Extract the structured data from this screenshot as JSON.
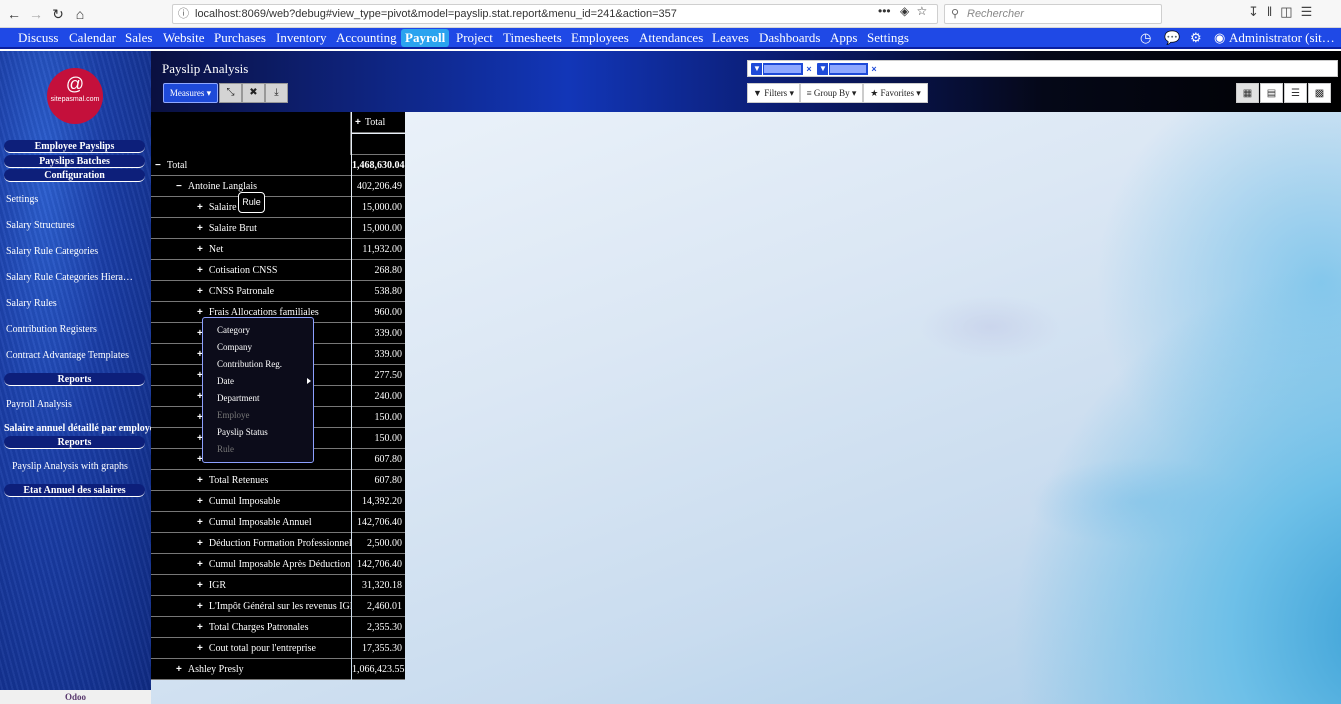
{
  "browser": {
    "url": "localhost:8069/web?debug#view_type=pivot&model=payslip.stat.report&menu_id=241&action=357",
    "url_actions": "•••",
    "search_placeholder": "Rechercher"
  },
  "topnav": {
    "items": [
      "Discuss",
      "Calendar",
      "Sales",
      "Website",
      "Purchases",
      "Inventory",
      "Accounting",
      "Payroll",
      "Project",
      "Timesheets",
      "Employees",
      "Attendances",
      "Leaves",
      "Dashboards",
      "Apps",
      "Settings"
    ],
    "active": "Payroll",
    "user": "Administrator (sit…"
  },
  "sidebar": {
    "logo_text": "sitepasmal.com",
    "logo_symbol": "@",
    "headers": [
      "Employee Payslips",
      "Payslips Batches",
      "Configuration"
    ],
    "config_items": [
      "Settings",
      "Salary Structures",
      "Salary Rule Categories",
      "Salary Rule Categories Hiera…",
      "Salary Rules",
      "Contribution Registers",
      "Contract Advantage Templates"
    ],
    "reports_header": "Reports",
    "report_item": "Payroll Analysis",
    "salaire_annuel": "Salaire annuel détaillé par employé",
    "reports_header_2": "Reports",
    "payslip_graphs": "Payslip Analysis with graphs",
    "etat_annuel": "Etat Annuel des salaires",
    "footer": "Odoo"
  },
  "control": {
    "title": "Payslip Analysis",
    "measures_label": "Measures ▾",
    "filters_label": "Filters ▾",
    "groupby_label": "Group By ▾",
    "favorites_label": "Favorites ▾",
    "facet_remove": "×"
  },
  "pivot": {
    "col_header": "Total",
    "rows": [
      {
        "label": "Total",
        "value": "1,468,630.04",
        "indent": 0,
        "sign": "−",
        "bold": true
      },
      {
        "label": "Antoine Langlais",
        "value": "402,206.49",
        "indent": 1,
        "sign": "−"
      },
      {
        "label": "Salaire",
        "value": "15,000.00",
        "indent": 2,
        "sign": "+"
      },
      {
        "label": "Salaire Brut",
        "value": "15,000.00",
        "indent": 2,
        "sign": "+"
      },
      {
        "label": "Net",
        "value": "11,932.00",
        "indent": 2,
        "sign": "+"
      },
      {
        "label": "Cotisation CNSS",
        "value": "268.80",
        "indent": 2,
        "sign": "+"
      },
      {
        "label": "CNSS Patronale",
        "value": "538.80",
        "indent": 2,
        "sign": "+"
      },
      {
        "label": "Frais Allocations familiales",
        "value": "960.00",
        "indent": 2,
        "sign": "+"
      },
      {
        "label": "",
        "value": "339.00",
        "indent": 2,
        "sign": "+"
      },
      {
        "label": "",
        "value": "339.00",
        "indent": 2,
        "sign": "+"
      },
      {
        "label": "",
        "value": "277.50",
        "indent": 2,
        "sign": "+"
      },
      {
        "label": "lle",
        "value": "240.00",
        "indent": 2,
        "sign": "+"
      },
      {
        "label": "",
        "value": "150.00",
        "indent": 2,
        "sign": "+"
      },
      {
        "label": "",
        "value": "150.00",
        "indent": 2,
        "sign": "+"
      },
      {
        "label": "",
        "value": "607.80",
        "indent": 2,
        "sign": "+"
      },
      {
        "label": "Total Retenues",
        "value": "607.80",
        "indent": 2,
        "sign": "+"
      },
      {
        "label": "Cumul Imposable",
        "value": "14,392.20",
        "indent": 2,
        "sign": "+"
      },
      {
        "label": "Cumul Imposable Annuel",
        "value": "142,706.40",
        "indent": 2,
        "sign": "+"
      },
      {
        "label": "Déduction Formation Professionnelle",
        "value": "2,500.00",
        "indent": 2,
        "sign": "+"
      },
      {
        "label": "Cumul Imposable Après Déduction",
        "value": "142,706.40",
        "indent": 2,
        "sign": "+"
      },
      {
        "label": "IGR",
        "value": "31,320.18",
        "indent": 2,
        "sign": "+"
      },
      {
        "label": "L'Impôt Général sur les revenus IGR",
        "value": "2,460.01",
        "indent": 2,
        "sign": "+"
      },
      {
        "label": "Total Charges Patronales",
        "value": "2,355.30",
        "indent": 2,
        "sign": "+"
      },
      {
        "label": "Cout total pour l'entreprise",
        "value": "17,355.30",
        "indent": 2,
        "sign": "+"
      },
      {
        "label": "Ashley Presly",
        "value": "1,066,423.55",
        "indent": 1,
        "sign": "+"
      }
    ]
  },
  "groupby_menu": {
    "items": [
      {
        "label": "Category",
        "disabled": false
      },
      {
        "label": "Company",
        "disabled": false
      },
      {
        "label": "Contribution Reg.",
        "disabled": false
      },
      {
        "label": "Date",
        "disabled": false
      },
      {
        "label": "Department",
        "disabled": false
      },
      {
        "label": "Employe",
        "disabled": true
      },
      {
        "label": "Payslip Status",
        "disabled": false
      },
      {
        "label": "Rule",
        "disabled": true
      }
    ]
  },
  "tooltip": "Rule"
}
